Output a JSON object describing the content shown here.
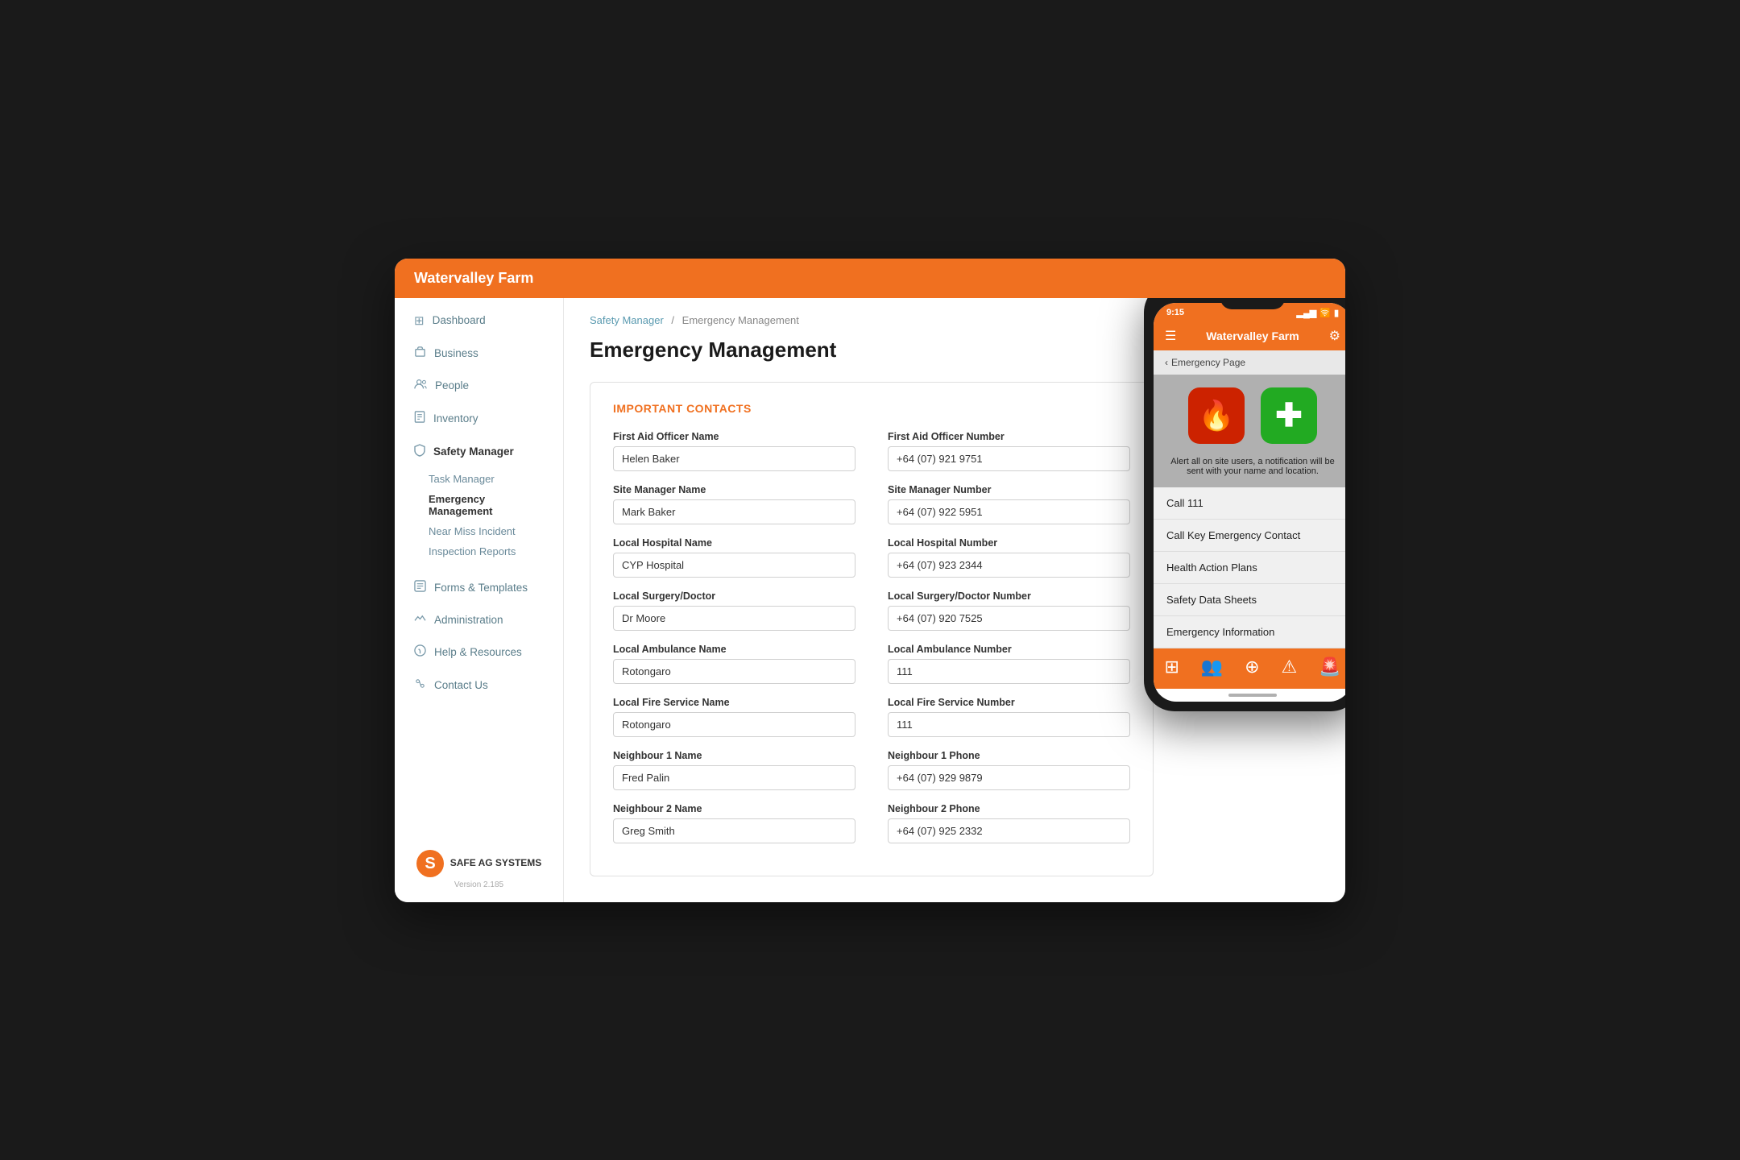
{
  "app": {
    "title": "Watervalley Farm",
    "version": "Version 2.185"
  },
  "sidebar": {
    "items": [
      {
        "id": "dashboard",
        "label": "Dashboard",
        "icon": "⊞"
      },
      {
        "id": "business",
        "label": "Business",
        "icon": "🏢"
      },
      {
        "id": "people",
        "label": "People",
        "icon": "👥"
      },
      {
        "id": "inventory",
        "label": "Inventory",
        "icon": "📋"
      },
      {
        "id": "safety-manager",
        "label": "Safety Manager",
        "icon": "🛡",
        "active": true
      },
      {
        "id": "forms-templates",
        "label": "Forms & Templates",
        "icon": "📊"
      },
      {
        "id": "administration",
        "label": "Administration",
        "icon": "📈"
      },
      {
        "id": "help-resources",
        "label": "Help & Resources",
        "icon": "⚙"
      },
      {
        "id": "contact-us",
        "label": "Contact Us",
        "icon": "🔗"
      }
    ],
    "safety_sub": [
      {
        "id": "task-manager",
        "label": "Task Manager"
      },
      {
        "id": "emergency-management",
        "label": "Emergency Management",
        "active": true
      },
      {
        "id": "near-miss",
        "label": "Near Miss Incident"
      },
      {
        "id": "inspection-reports",
        "label": "Inspection Reports"
      }
    ]
  },
  "breadcrumb": {
    "parent": "Safety Manager",
    "current": "Emergency Management",
    "separator": "/"
  },
  "page": {
    "title": "Emergency Management",
    "contacts_heading": "IMPORTANT CONTACTS"
  },
  "contacts": [
    {
      "left_label": "First Aid Officer Name",
      "left_value": "Helen Baker",
      "right_label": "First Aid Officer Number",
      "right_value": "+64 (07) 921 9751"
    },
    {
      "left_label": "Site Manager Name",
      "left_value": "Mark Baker",
      "right_label": "Site Manager Number",
      "right_value": "+64 (07) 922 5951"
    },
    {
      "left_label": "Local Hospital Name",
      "left_value": "CYP Hospital",
      "right_label": "Local Hospital Number",
      "right_value": "+64 (07) 923 2344"
    },
    {
      "left_label": "Local Surgery/Doctor",
      "left_value": "Dr Moore",
      "right_label": "Local Surgery/Doctor Number",
      "right_value": "+64 (07) 920 7525"
    },
    {
      "left_label": "Local Ambulance Name",
      "left_value": "Rotongaro",
      "right_label": "Local Ambulance Number",
      "right_value": "111"
    },
    {
      "left_label": "Local Fire Service Name",
      "left_value": "Rotongaro",
      "right_label": "Local Fire Service Number",
      "right_value": "111"
    },
    {
      "left_label": "Neighbour 1 Name",
      "left_value": "Fred Palin",
      "right_label": "Neighbour 1 Phone",
      "right_value": "+64 (07) 929 9879"
    },
    {
      "left_label": "Neighbour 2 Name",
      "left_value": "Greg Smith",
      "right_label": "Neighbour 2 Phone",
      "right_value": "+64 (07) 925 2332"
    }
  ],
  "phone": {
    "status_time": "9:15",
    "app_title": "Watervalley Farm",
    "back_label": "Emergency Page",
    "alert_text": "Alert all on site users, a notification will be sent with your name and location.",
    "list_items": [
      "Call 111",
      "Call Key Emergency Contact",
      "Health Action Plans",
      "Safety Data Sheets",
      "Emergency Information"
    ]
  },
  "logo": {
    "name": "SAFE AG SYSTEMS"
  }
}
